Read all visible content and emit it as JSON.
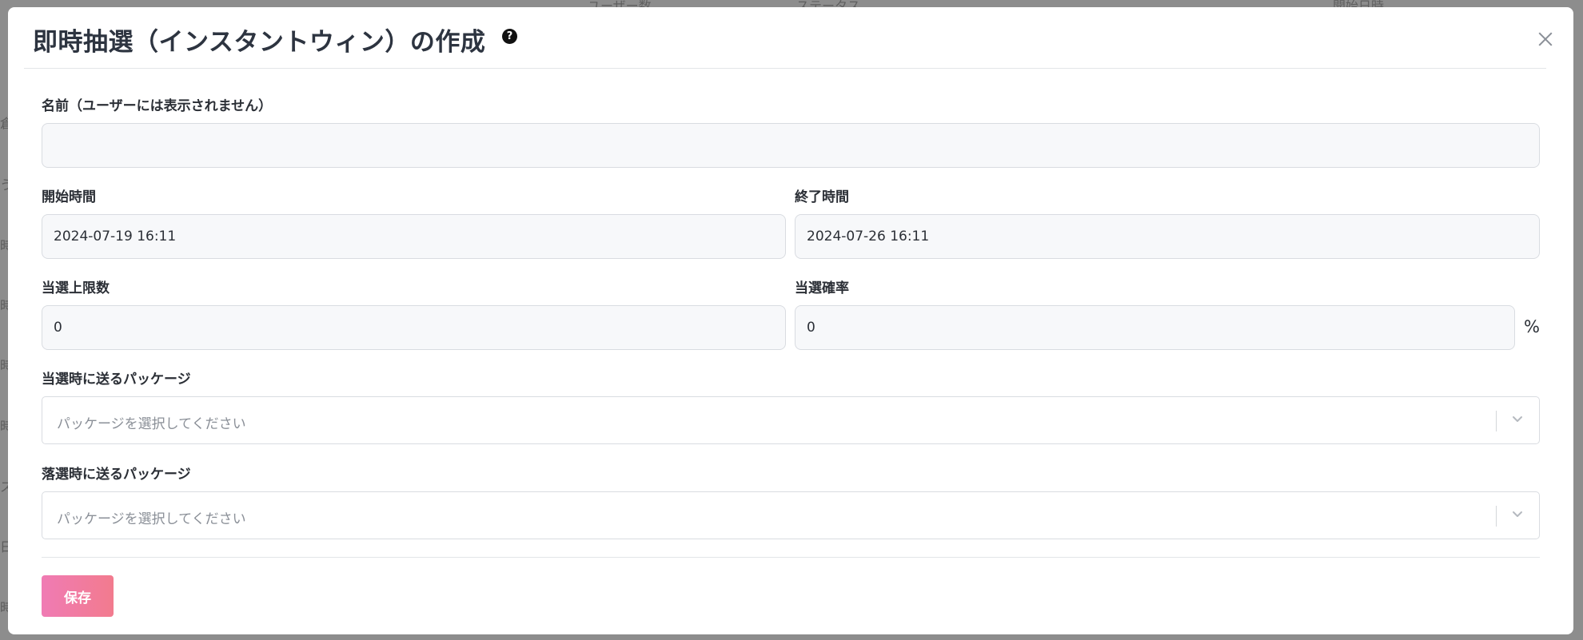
{
  "background": {
    "header_fragments": [
      "ユーザー数",
      "ステータス",
      "開始日時"
    ],
    "side_fragments": [
      "倉",
      "う",
      "時",
      "時",
      "時",
      "時",
      "ス",
      "日",
      "時"
    ]
  },
  "modal": {
    "title": "即時抽選（インスタントウィン）の作成",
    "help_icon": "question-circle-icon",
    "close_icon": "close-icon"
  },
  "form": {
    "name": {
      "label": "名前（ユーザーには表示されません）",
      "value": ""
    },
    "start_time": {
      "label": "開始時間",
      "value": "2024-07-19 16:11"
    },
    "end_time": {
      "label": "終了時間",
      "value": "2024-07-26 16:11"
    },
    "win_limit": {
      "label": "当選上限数",
      "value": "0"
    },
    "win_rate": {
      "label": "当選確率",
      "value": "0",
      "unit": "%"
    },
    "win_package": {
      "label": "当選時に送るパッケージ",
      "placeholder": "パッケージを選択してください"
    },
    "lose_package": {
      "label": "落選時に送るパッケージ",
      "placeholder": "パッケージを選択してください"
    },
    "save_label": "保存"
  },
  "colors": {
    "save_gradient_start": "#f07bb4",
    "save_gradient_end": "#f27b8e",
    "title_text": "#2d3440"
  }
}
